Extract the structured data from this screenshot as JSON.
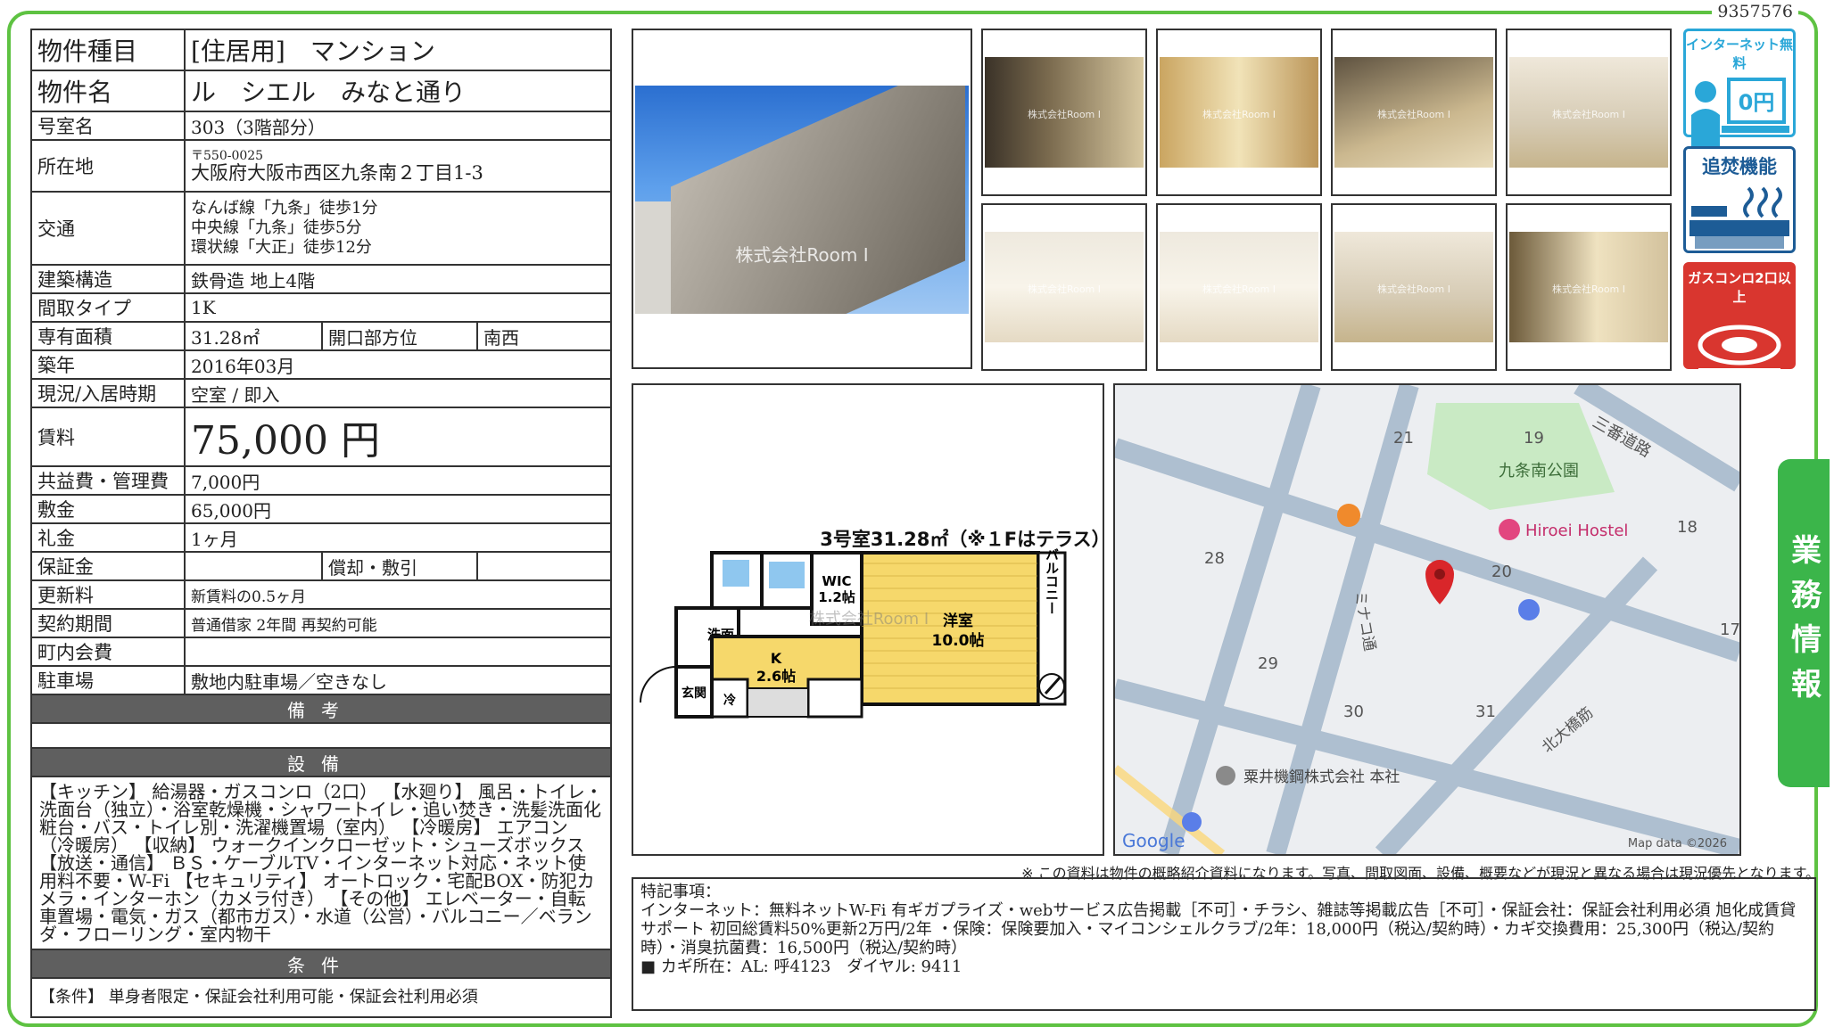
{
  "doc_id": "9357576",
  "side_tab": "業務情報",
  "info": {
    "type_label": "物件種目",
    "type_value": "[住居用]　マンション",
    "name_label": "物件名",
    "name_value": "ル　シエル　みなと通り",
    "room_label": "号室名",
    "room_value": "303（3階部分）",
    "addr_label": "所在地",
    "addr_zip": "〒550-0025",
    "addr_value": "大阪府大阪市西区九条南２丁目1-3",
    "transit_label": "交通",
    "transit": [
      "なんば線「九条」徒歩1分",
      "中央線「九条」徒歩5分",
      "環状線「大正」徒歩12分"
    ],
    "struct_label": "建築構造",
    "struct_value": "鉄骨造 地上4階",
    "layout_label": "間取タイプ",
    "layout_value": "1K",
    "area_label": "専有面積",
    "area_value": "31.28㎡",
    "dir_label": "開口部方位",
    "dir_value": "南西",
    "built_label": "築年",
    "built_value": "2016年03月",
    "status_label": "現況/入居時期",
    "status_value": "空室 / 即入",
    "rent_label": "賃料",
    "rent_value": "75,000 円",
    "fee_label": "共益費・管理費",
    "fee_value": "7,000円",
    "deposit_label": "敷金",
    "deposit_value": "65,000円",
    "key_label": "礼金",
    "key_value": "1ヶ月",
    "guar_label": "保証金",
    "guar_value": "",
    "amort_label": "償却・敷引",
    "amort_value": "",
    "renew_label": "更新料",
    "renew_value": "新賃料の0.5ヶ月",
    "contract_label": "契約期間",
    "contract_value": "普通借家 2年間 再契約可能",
    "town_label": "町内会費",
    "town_value": "",
    "parking_label": "駐車場",
    "parking_value": "敷地内駐車場／空きなし"
  },
  "sections": {
    "remarks_title": "備考",
    "remarks_body": "",
    "equip_title": "設備",
    "equip_body": "【キッチン】 給湯器・ガスコンロ（2口） 【水廻り】 風呂・トイレ・洗面台（独立）・浴室乾燥機・シャワートイレ・追い焚き・洗髪洗面化粧台・バス・トイレ別・洗濯機置場（室内） 【冷暖房】 エアコン（冷暖房） 【収納】 ウォークインクローゼット・シューズボックス 【放送・通信】 ＢＳ・ケーブルTV・インターネット対応・ネット使用料不要・W-Fi 【セキュリティ】 オートロック・宅配BOX・防犯カメラ・インターホン（カメラ付き） 【その他】 エレベーター・自転車置場・電気・ガス（都市ガス）・水道（公営）・バルコニー／ベランダ・フローリング・室内物干",
    "cond_title": "条件",
    "cond_body": "【条件】 単身者限定・保証会社利用可能・保証会社利用必須"
  },
  "photos": {
    "watermark_main": "株式会社Room I",
    "watermark": "株式会社Room I"
  },
  "icons": {
    "internet": "インターネット無料",
    "internet_price": "0円",
    "reheat": "追焚機能",
    "gas": "ガスコンロ2口以上"
  },
  "floorplan": {
    "title": "3号室31.28㎡（※１Fはテラス）",
    "western": "洋室",
    "western_size": "10.0帖",
    "kitchen": "K",
    "kitchen_size": "2.6帖",
    "wic": "WIC",
    "wic_size": "1.2帖",
    "washroom": "洗面",
    "entrance": "玄関",
    "fridge": "冷",
    "balcony": "バルコニー",
    "watermark": "株式会社Room I"
  },
  "map": {
    "park": "九条南公園",
    "hostel": "Hiroei Hostel",
    "road1": "三番道路",
    "road2": "ミナコ通",
    "road3": "北大橋筋",
    "company": "粟井機鋼株式会社 本社",
    "blocks": [
      "21",
      "19",
      "18",
      "28",
      "20",
      "17",
      "29",
      "30",
      "31"
    ],
    "google": "Google",
    "credit": "Map data ©2026"
  },
  "note": "※ この資料は物件の概略紹介資料になります。写真、間取図面、設備、概要などが現況と異なる場合は現況優先となります。",
  "special": {
    "title": "特記事項：",
    "body": "インターネット：無料ネットW-Fi 有ギガプライズ・webサービス広告掲載［不可］・チラシ、雑誌等掲載広告［不可］・保証会社：保証会社利用必須 旭化成賃貸サポート 初回総賃料50%更新2万円/2年 ・保険：保険要加入・マイコンシェルクラブ/2年：18,000円（税込/契約時）・カギ交換費用：25,300円（税込/契約時）・消臭抗菌費：16,500円（税込/契約時）",
    "key_line": "■ カギ所在：AL: 呼4123　ダイヤル: 9411"
  }
}
